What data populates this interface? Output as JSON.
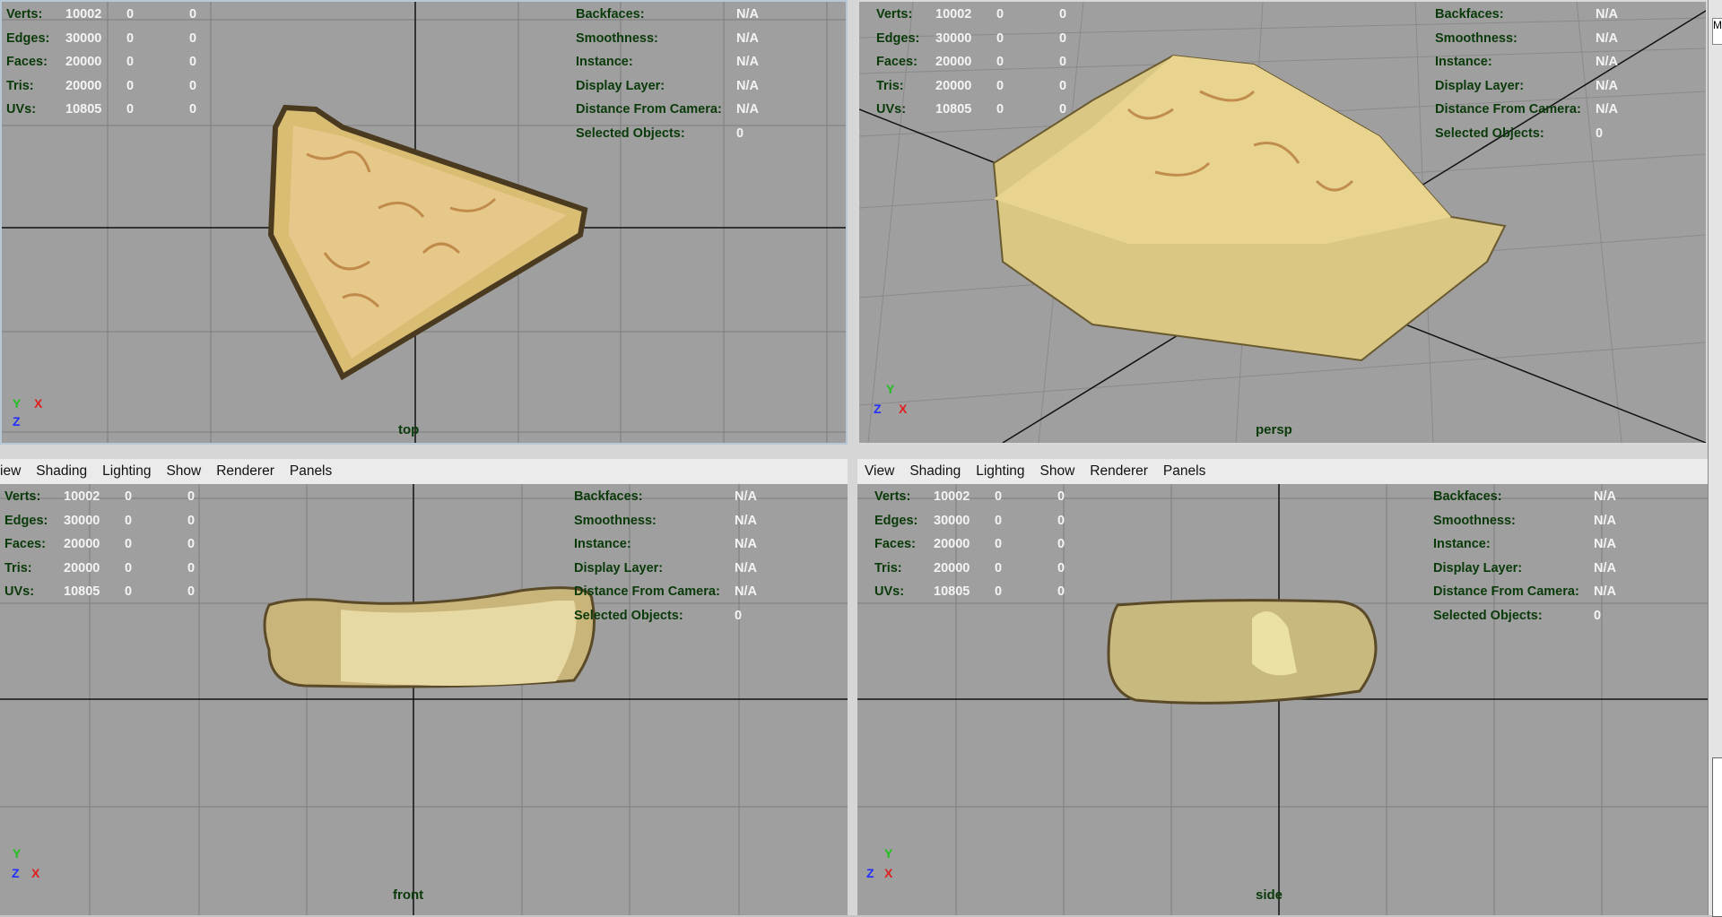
{
  "stats": {
    "left": [
      {
        "label": "Verts:",
        "a": "10002",
        "b": "0",
        "c": "0"
      },
      {
        "label": "Edges:",
        "a": "30000",
        "b": "0",
        "c": "0"
      },
      {
        "label": "Faces:",
        "a": "20000",
        "b": "0",
        "c": "0"
      },
      {
        "label": "Tris:",
        "a": "20000",
        "b": "0",
        "c": "0"
      },
      {
        "label": "UVs:",
        "a": "10805",
        "b": "0",
        "c": "0"
      }
    ],
    "right": [
      {
        "label": "Backfaces:",
        "value": "N/A"
      },
      {
        "label": "Smoothness:",
        "value": "N/A"
      },
      {
        "label": "Instance:",
        "value": "N/A"
      },
      {
        "label": "Display Layer:",
        "value": "N/A"
      },
      {
        "label": "Distance From Camera:",
        "value": "N/A"
      },
      {
        "label": "Selected Objects:",
        "value": "0"
      }
    ]
  },
  "viewports": {
    "top": {
      "camera": "top"
    },
    "persp": {
      "camera": "persp"
    },
    "front": {
      "camera": "front"
    },
    "side": {
      "camera": "side"
    }
  },
  "menu": {
    "items": [
      "View",
      "Shading",
      "Lighting",
      "Show",
      "Renderer",
      "Panels"
    ],
    "left_items": [
      "iew",
      "Shading",
      "Lighting",
      "Show",
      "Renderer",
      "Panels"
    ]
  },
  "axes": {
    "x": "X",
    "y": "Y",
    "z": "Z"
  },
  "colors": {
    "viewport_bg": "#9f9f9f",
    "hud_label": "#0a3a0a",
    "grid": "#7d7d7d",
    "axis": "#111111",
    "x_axis": "#e02020",
    "y_axis": "#20c020",
    "z_axis": "#2030ff"
  },
  "right_edge": {
    "tab": "M"
  }
}
